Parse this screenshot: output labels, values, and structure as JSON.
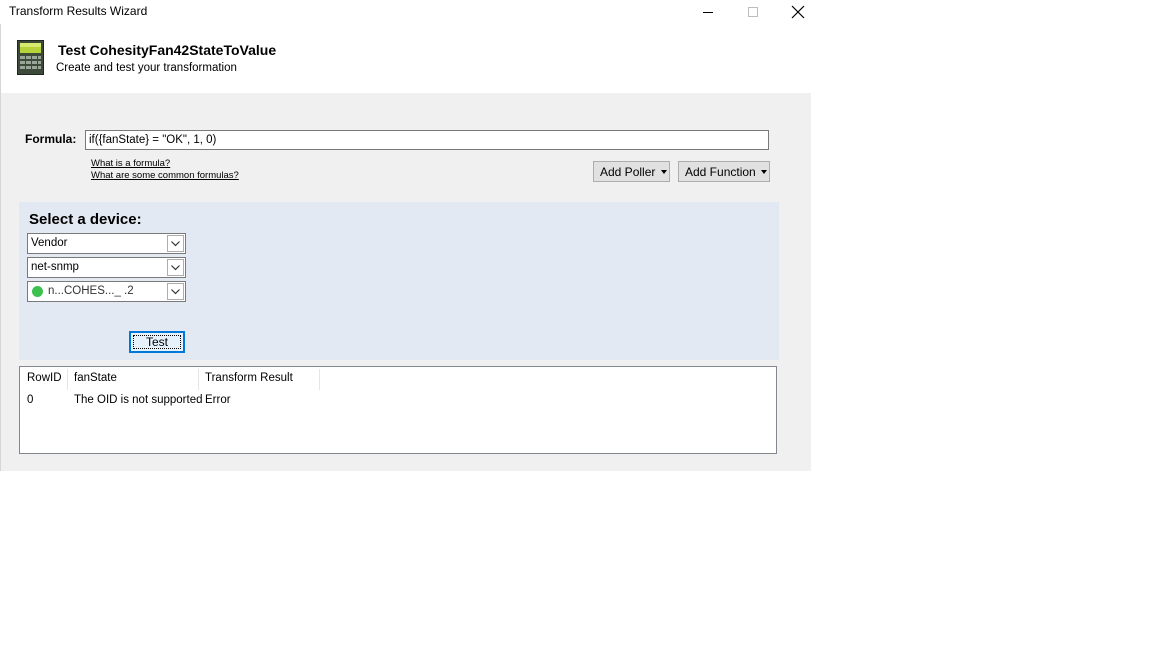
{
  "window": {
    "title": "Transform Results Wizard",
    "controls": {
      "minimize": "—",
      "maximize": "☐",
      "close": "✕"
    }
  },
  "header": {
    "title": "Test CohesityFan42StateToValue",
    "subtitle": "Create and test your transformation",
    "icon": "calculator-icon"
  },
  "formula": {
    "label": "Formula:",
    "value": "if({fanState} = \"OK\", 1, 0)",
    "links": [
      "What is a formula?",
      "What are some common formulas?"
    ],
    "add_poller_label": "Add Poller",
    "add_function_label": "Add Function"
  },
  "device": {
    "title": "Select a device:",
    "vendor_value": "Vendor",
    "type_value": "net-snmp",
    "node_value": "n...COHES..._ .2",
    "status_color": "#3cc14f",
    "test_label": "Test"
  },
  "results": {
    "columns": [
      "RowID",
      "fanState",
      "Transform Result"
    ],
    "rows": [
      [
        "0",
        "The OID is not supported",
        "Error"
      ]
    ]
  }
}
